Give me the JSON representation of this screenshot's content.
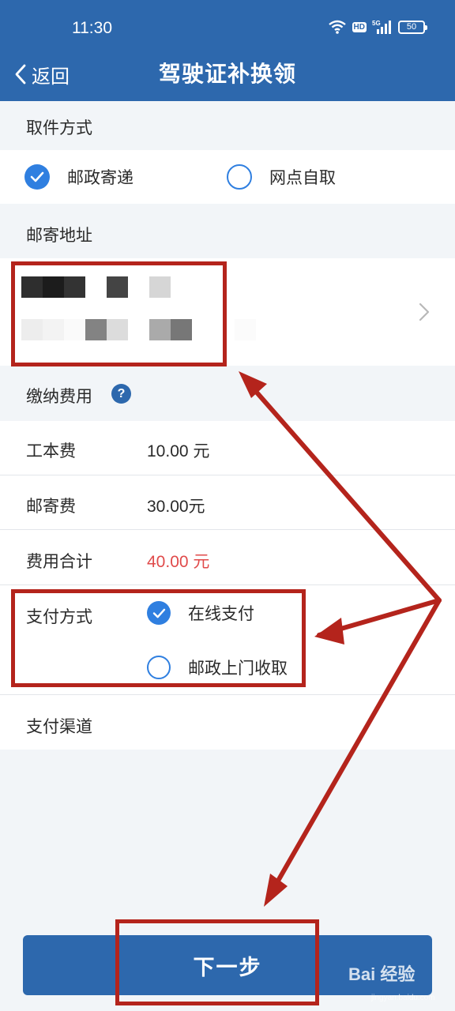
{
  "status_bar": {
    "time": "11:30",
    "hd_label": "HD",
    "network_label": "5G",
    "battery": "50"
  },
  "header": {
    "back_label": "返回",
    "title": "驾驶证补换领"
  },
  "pickup": {
    "section_label": "取件方式",
    "options": [
      {
        "label": "邮政寄递",
        "checked": true
      },
      {
        "label": "网点自取",
        "checked": false
      }
    ]
  },
  "address": {
    "section_label": "邮寄地址"
  },
  "fees": {
    "section_label": "缴纳费用",
    "help_icon": "?",
    "items": [
      {
        "label": "工本费",
        "value": "10.00 元"
      },
      {
        "label": "邮寄费",
        "value": "30.00元"
      },
      {
        "label": "费用合计",
        "value": "40.00 元",
        "highlight": true
      }
    ]
  },
  "payment": {
    "label": "支付方式",
    "options": [
      {
        "label": "在线支付",
        "checked": true
      },
      {
        "label": "邮政上门收取",
        "checked": false
      }
    ]
  },
  "channel": {
    "label": "支付渠道"
  },
  "footer": {
    "next_label": "下一步"
  },
  "watermark": {
    "text": "Bai 经验",
    "sub": "jingyan.baidu.com"
  },
  "colors": {
    "header": "#2d68ad",
    "accent": "#2f7fe0",
    "total": "#e04a4a",
    "annotation": "#b4241c"
  }
}
